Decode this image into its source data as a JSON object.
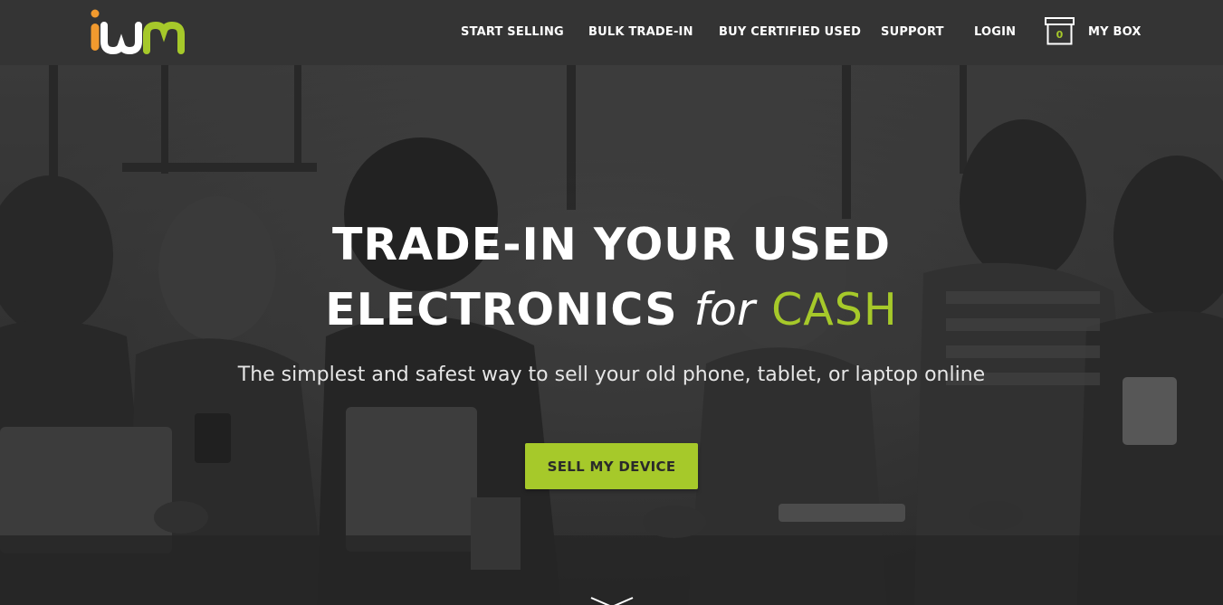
{
  "brand": {
    "logo_text": "iwm",
    "colors": {
      "orange": "#f29a2e",
      "white": "#ffffff",
      "green": "#a6c92a"
    }
  },
  "nav": {
    "items": [
      {
        "label": "START SELLING"
      },
      {
        "label": "BULK TRADE-IN"
      },
      {
        "label": "BUY CERTIFIED USED"
      },
      {
        "label": "SUPPORT"
      },
      {
        "label": "LOGIN"
      }
    ],
    "box": {
      "count": "0",
      "label": "MY BOX",
      "icon": "box-icon"
    }
  },
  "hero": {
    "title_line1": "TRADE-IN YOUR USED",
    "title_line2_main": "ELECTRONICS",
    "title_line2_for": "for",
    "title_line2_cash": "CASH",
    "subtitle": "The simplest and safest way to sell your old phone, tablet, or laptop online",
    "cta_label": "SELL MY DEVICE",
    "scroll_icon": "chevron-down-icon"
  },
  "colors": {
    "header_bg": "#343434",
    "accent": "#a6c92a",
    "hero_overlay": "#3a3a3a"
  }
}
